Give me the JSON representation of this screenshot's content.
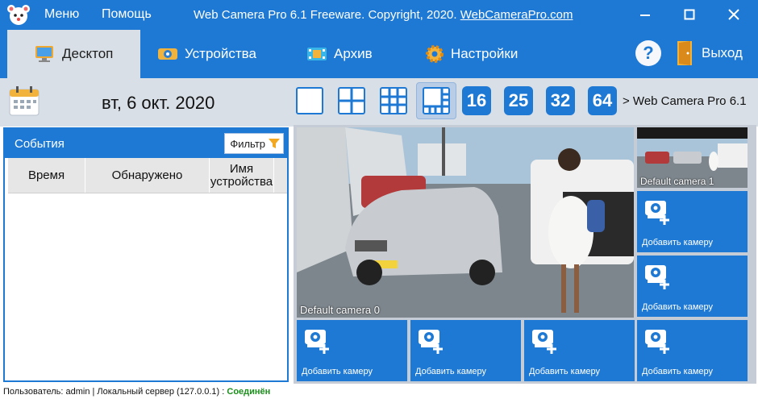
{
  "titlebar": {
    "menu": "Меню",
    "help": "Помощь",
    "title_prefix": "Web Camera Pro 6.1 Freeware. Copyright, 2020.",
    "title_link": "WebCameraPro.com"
  },
  "tabs": [
    {
      "label": "Десктоп",
      "icon": "monitor-icon"
    },
    {
      "label": "Устройства",
      "icon": "camera-icon"
    },
    {
      "label": "Архив",
      "icon": "film-icon"
    },
    {
      "label": "Настройки",
      "icon": "gear-icon"
    }
  ],
  "toolbar": {
    "help": "?",
    "exit": "Выход"
  },
  "date": "вт, 6 окт. 2020",
  "layouts": {
    "n16": "16",
    "n25": "25",
    "n32": "32",
    "n64": "64"
  },
  "breadcrumb": "> Web Camera Pro 6.1",
  "events": {
    "title": "События",
    "filter": "Фильтр",
    "columns": [
      "Время",
      "Обнаружено",
      "Имя устройства"
    ]
  },
  "cameras": {
    "main_label": "Default camera 0",
    "thumb_label": "Default camera 1",
    "add_label": "Добавить камеру"
  },
  "status": {
    "prefix": "Пользователь: admin | Локальный сервер (127.0.0.1) :",
    "state": "Соединён"
  },
  "colors": {
    "accent": "#1e79d4",
    "toolbar_bg": "#d9dfe6",
    "connected": "#1b8e1b"
  }
}
